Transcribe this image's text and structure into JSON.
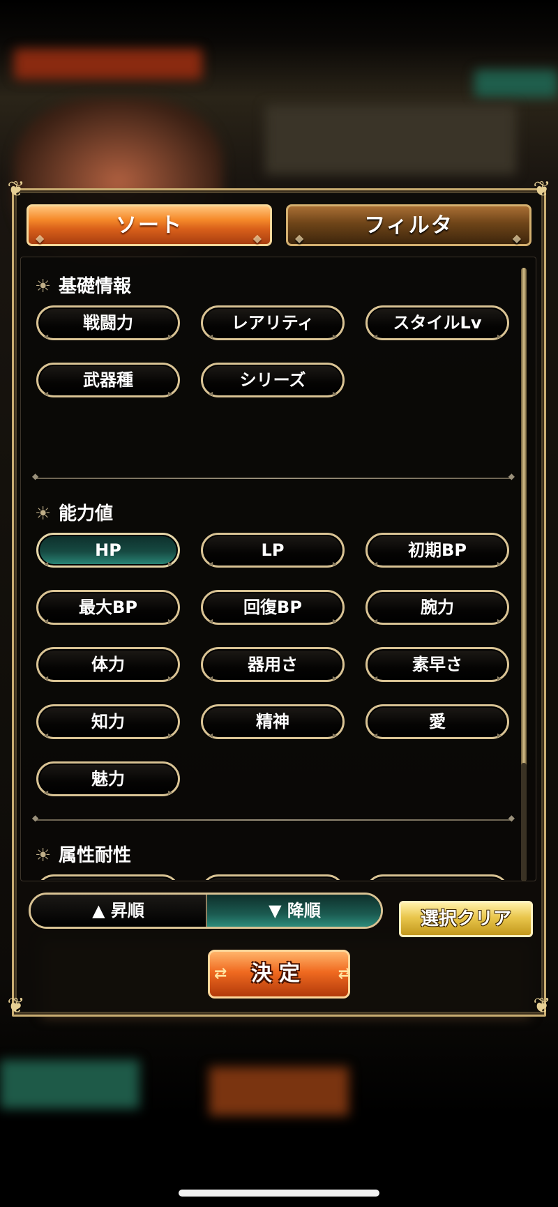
{
  "tabs": {
    "sort": "ソート",
    "filter": "フィルタ"
  },
  "sections": [
    {
      "title": "基礎情報",
      "buttons": [
        "戦闘力",
        "レアリティ",
        "スタイルLv",
        "武器種",
        "シリーズ"
      ]
    },
    {
      "title": "能力値",
      "buttons": [
        "HP",
        "LP",
        "初期BP",
        "最大BP",
        "回復BP",
        "腕力",
        "体力",
        "器用さ",
        "素早さ",
        "知力",
        "精神",
        "愛",
        "魅力"
      ],
      "selected": "HP"
    },
    {
      "title": "属性耐性"
    }
  ],
  "order": {
    "ascending": "▲ 昇順",
    "descending": "▼ 降順",
    "selected": "descending"
  },
  "actions": {
    "clear": "選択クリア",
    "confirm": "決定"
  },
  "icons": {
    "section": "sun-emblem-icon",
    "corner": "ornate-corner-icon"
  },
  "colors": {
    "accent_orange": "#e5661c",
    "gold_border": "#d9c394",
    "selected_teal": "#1b5a50"
  }
}
